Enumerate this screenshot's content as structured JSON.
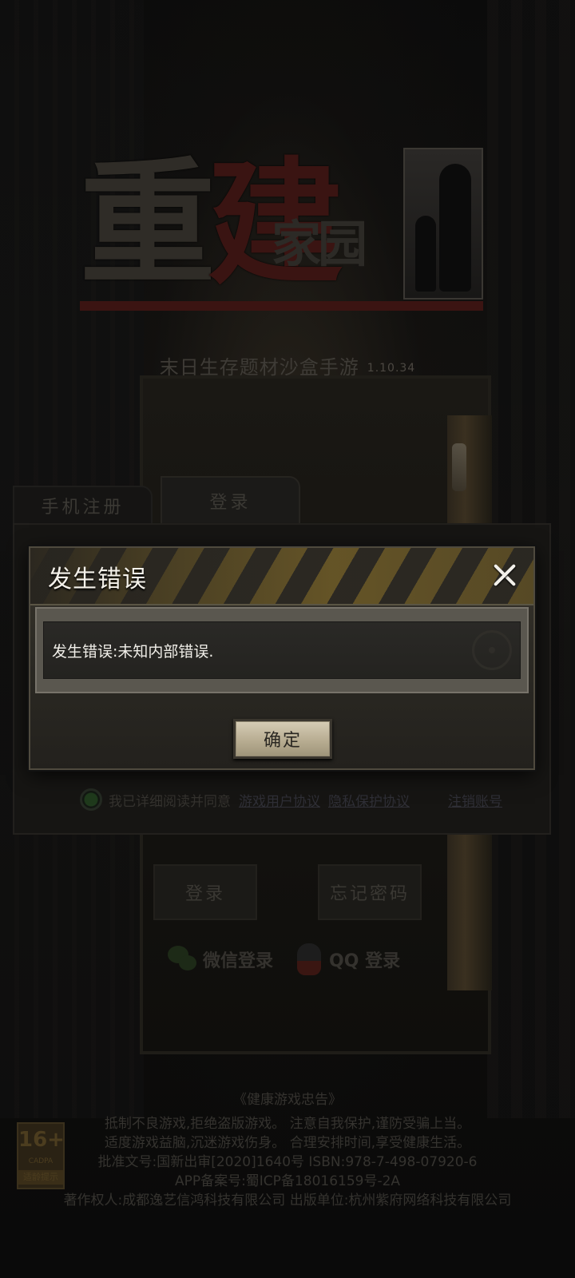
{
  "logo": {
    "main_char1": "重",
    "main_char2": "建",
    "sub": "家园"
  },
  "tagline": "末日生存题材沙盒手游",
  "version": "1.10.34",
  "tabs": [
    {
      "label": "手机注册"
    },
    {
      "label": "登录"
    }
  ],
  "agreement": {
    "text": "我已详细阅读并同意",
    "user_agreement": "游戏用户协议",
    "privacy_agreement": "隐私保护协议",
    "cancel_account": "注销账号"
  },
  "buttons": {
    "login": "登录",
    "forgot_password": "忘记密码"
  },
  "social": {
    "wechat": "微信登录",
    "qq": "QQ 登录"
  },
  "dialog": {
    "title": "发生错误",
    "message": "发生错误:未知内部错误.",
    "confirm": "确定"
  },
  "age_rating": {
    "age": "16+",
    "org": "CADPA",
    "label": "适龄提示"
  },
  "notice": {
    "title": "《健康游戏忠告》",
    "lines": [
      "抵制不良游戏,拒绝盗版游戏。 注意自我保护,谨防受骗上当。",
      "适度游戏益脑,沉迷游戏伤身。 合理安排时间,享受健康生活。",
      "批准文号:国新出审[2020]1640号    ISBN:978-7-498-07920-6",
      "APP备案号:蜀ICP备18016159号-2A",
      "著作权人:成都逸艺信鸿科技有限公司 出版单位:杭州紫府网络科技有限公司"
    ]
  },
  "colors": {
    "confirm_button": "#c4baa0",
    "dialog_bg": "#2c2a24",
    "hazard_stripe": "#6f5c28"
  }
}
